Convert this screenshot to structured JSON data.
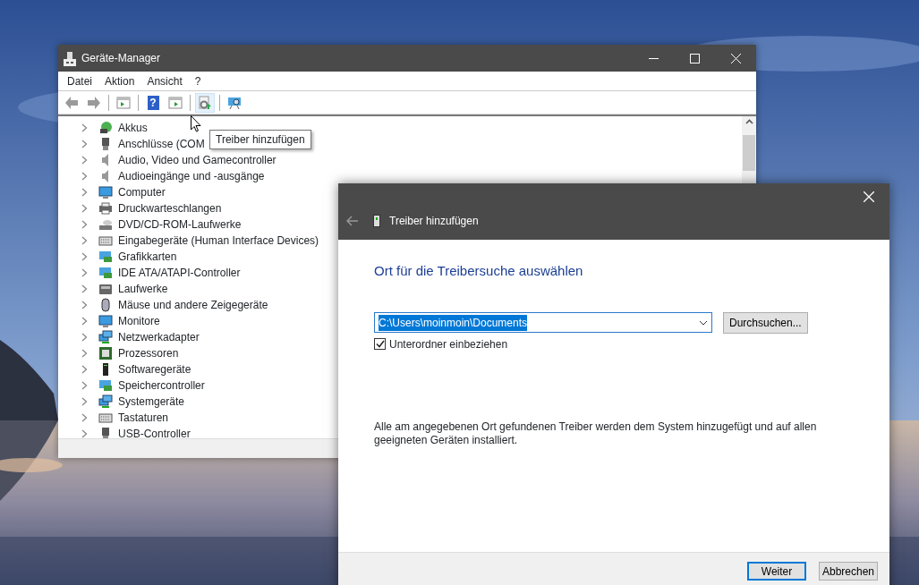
{
  "device_manager": {
    "title": "Geräte-Manager",
    "menu": [
      "Datei",
      "Aktion",
      "Ansicht",
      "?"
    ],
    "toolbar": [
      {
        "kind": "back",
        "highlighted": false
      },
      {
        "kind": "forward",
        "highlighted": false
      },
      {
        "kind": "separator"
      },
      {
        "kind": "panel",
        "highlighted": false
      },
      {
        "kind": "separator"
      },
      {
        "kind": "help",
        "glyph": "?",
        "highlighted": false
      },
      {
        "kind": "panel-right",
        "highlighted": false
      },
      {
        "kind": "separator"
      },
      {
        "kind": "add-driver",
        "highlighted": true
      },
      {
        "kind": "separator"
      },
      {
        "kind": "scan",
        "highlighted": false
      }
    ],
    "tooltip": "Treiber hinzufügen",
    "tree": [
      {
        "label": "Akkus",
        "kind": "battery",
        "expanded": false
      },
      {
        "label": "Anschlüsse (COM",
        "kind": "port",
        "expanded": false
      },
      {
        "label": "Audio, Video und Gamecontroller",
        "kind": "speaker",
        "expanded": false
      },
      {
        "label": "Audioeingänge und -ausgänge",
        "kind": "speaker",
        "expanded": false
      },
      {
        "label": "Computer",
        "kind": "monitor",
        "expanded": false
      },
      {
        "label": "Druckwarteschlangen",
        "kind": "printer",
        "expanded": false
      },
      {
        "label": "DVD/CD-ROM-Laufwerke",
        "kind": "disc",
        "expanded": false
      },
      {
        "label": "Eingabegeräte (Human Interface Devices)",
        "kind": "keyboard",
        "expanded": false
      },
      {
        "label": "Grafikkarten",
        "kind": "card",
        "expanded": false
      },
      {
        "label": "IDE ATA/ATAPI-Controller",
        "kind": "card",
        "expanded": false
      },
      {
        "label": "Laufwerke",
        "kind": "drive",
        "expanded": false
      },
      {
        "label": "Mäuse und andere Zeigegeräte",
        "kind": "mouse",
        "expanded": false
      },
      {
        "label": "Monitore",
        "kind": "monitor",
        "expanded": false
      },
      {
        "label": "Netzwerkadapter",
        "kind": "network",
        "expanded": false
      },
      {
        "label": "Prozessoren",
        "kind": "chip",
        "expanded": false
      },
      {
        "label": "Softwaregeräte",
        "kind": "tower",
        "expanded": false
      },
      {
        "label": "Speichercontroller",
        "kind": "card",
        "expanded": false
      },
      {
        "label": "Systemgeräte",
        "kind": "network",
        "expanded": false
      },
      {
        "label": "Tastaturen",
        "kind": "keyboard",
        "expanded": false
      },
      {
        "label": "USB-Controller",
        "kind": "port",
        "expanded": false
      }
    ]
  },
  "dialog": {
    "title": "Treiber hinzufügen",
    "heading": "Ort für die Treibersuche auswählen",
    "path": {
      "value": "C:\\Users\\moinmoin\\Documents",
      "selected": true
    },
    "browse": "Durchsuchen...",
    "subfolders": {
      "label": "Unterordner einbeziehen",
      "checked": true
    },
    "info": "Alle am angegebenen Ort gefundenen Treiber werden dem System hinzugefügt und auf allen geeigneten Geräten installiert.",
    "buttons": [
      {
        "label": "Weiter",
        "default": true
      },
      {
        "label": "Abbrechen",
        "default": false
      }
    ]
  }
}
